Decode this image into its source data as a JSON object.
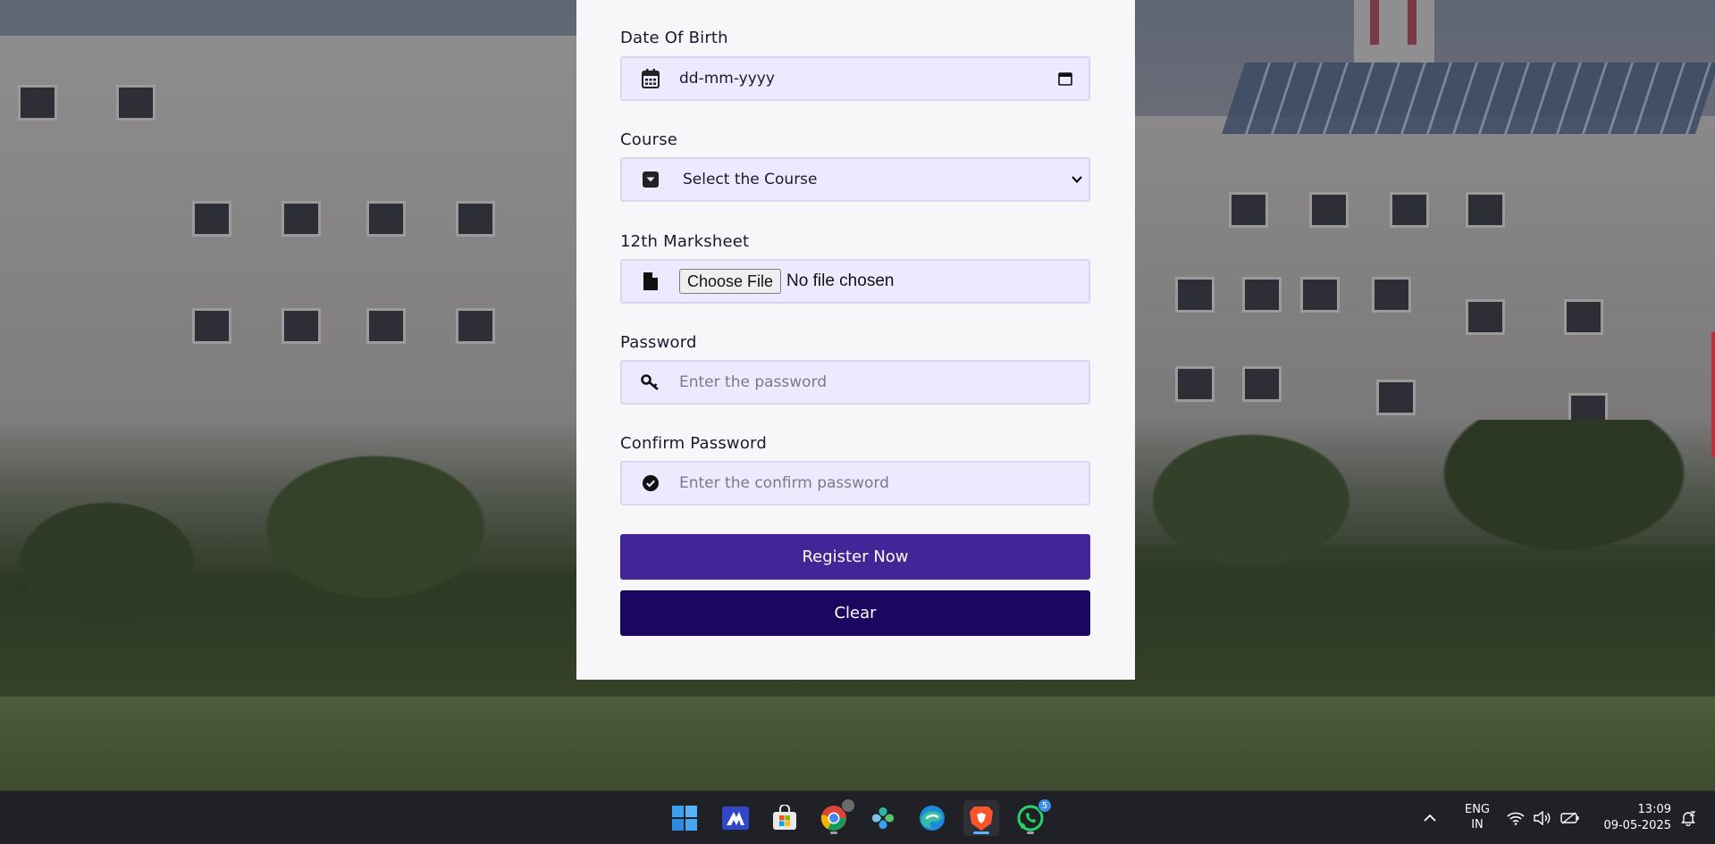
{
  "form": {
    "dob": {
      "label": "Date Of Birth",
      "value": "dd-mm-yyyy"
    },
    "course": {
      "label": "Course",
      "selected": "Select the Course"
    },
    "marksheet": {
      "label": "12th Marksheet",
      "button": "Choose File",
      "status": "No file chosen"
    },
    "password": {
      "label": "Password",
      "placeholder": "Enter the password"
    },
    "confirm_password": {
      "label": "Confirm Password",
      "placeholder": "Enter the confirm password"
    },
    "register_label": "Register Now",
    "clear_label": "Clear"
  },
  "colors": {
    "field_bg": "#eceaff",
    "register_button": "#442597",
    "clear_button": "#1b0660"
  },
  "taskbar": {
    "apps": [
      {
        "name": "start-icon"
      },
      {
        "name": "app-icon"
      },
      {
        "name": "microsoft-store-icon"
      },
      {
        "name": "chrome-icon"
      },
      {
        "name": "photos-icon"
      },
      {
        "name": "edge-icon"
      },
      {
        "name": "brave-icon"
      },
      {
        "name": "whatsapp-icon",
        "badge": "5"
      }
    ],
    "lang_line1": "ENG",
    "lang_line2": "IN",
    "time": "13:09",
    "date": "09-05-2025"
  }
}
